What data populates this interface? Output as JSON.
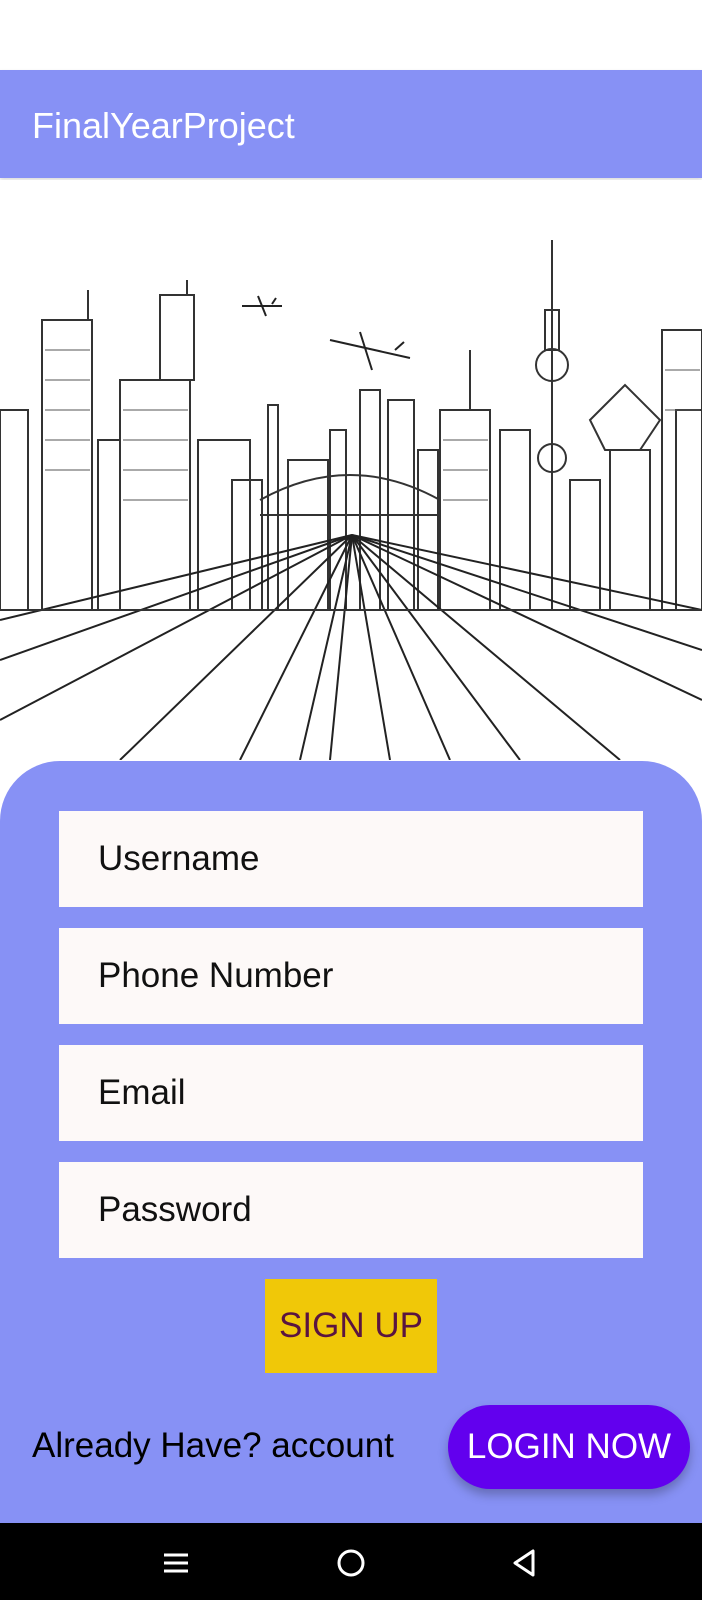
{
  "app_bar": {
    "title": "FinalYearProject"
  },
  "hero": {
    "description_icon": "city-skyline-illustration"
  },
  "form": {
    "username_placeholder": "Username",
    "phone_placeholder": "Phone Number",
    "email_placeholder": "Email",
    "password_placeholder": "Password",
    "signup_label": "SIGN UP"
  },
  "footer": {
    "already_text": "Already Have? account",
    "login_label": "LOGIN NOW"
  },
  "nav": {
    "recents_icon": "recents-icon",
    "home_icon": "home-icon",
    "back_icon": "back-icon"
  },
  "colors": {
    "primary": "#8791f5",
    "field_bg": "#fdf9f8",
    "signup_bg": "#f0c808",
    "signup_text": "#5a1440",
    "login_bg": "#6200ee",
    "nav_bg": "#000000"
  }
}
